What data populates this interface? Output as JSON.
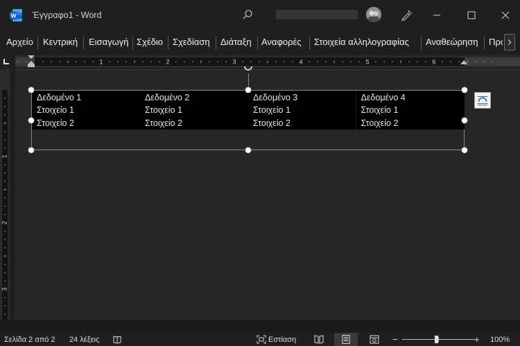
{
  "titlebar": {
    "document_title": "Έγγραφο1 - Word",
    "icons": [
      "word-logo-icon",
      "search-icon",
      "avatar",
      "pen-icon",
      "minimize-icon",
      "maximize-icon",
      "close-icon"
    ]
  },
  "ribbon": {
    "tabs": [
      "Αρχείο",
      "Κεντρική",
      "Εισαγωγή",
      "Σχέδιο",
      "Σχεδίαση",
      "Διάταξη",
      "Αναφορές",
      "Στοιχεία αλληλογραφίας",
      "Αναθεώρηση",
      "Προ"
    ]
  },
  "ruler": {
    "horizontal_numbers": [
      "1",
      "2",
      "3",
      "4",
      "5",
      "6"
    ],
    "vertical_numbers": [
      "1",
      "2",
      "3"
    ]
  },
  "document": {
    "table": {
      "rows": [
        [
          "Δεδομένο 1",
          "Δεδομένο 2",
          "Δεδομένο 3",
          "Δεδομένο 4"
        ],
        [
          "Στοιχείο 1",
          "Στοιχείο 1",
          "Στοιχείο 1",
          "Στοιχείο 1"
        ],
        [
          "Στοιχείο 2",
          "Στοιχείο 2",
          "Στοιχείο 2",
          "Στοιχείο 2"
        ]
      ]
    }
  },
  "statusbar": {
    "page_info": "Σελίδα 2 από 2",
    "word_count": "24 λέξεις",
    "focus_label": "Εστίαση",
    "zoom_minus": "−",
    "zoom_plus": "+",
    "zoom_level": "100%"
  },
  "colors": {
    "word_blue": "#185abd",
    "background": "#1f1f1f",
    "canvas": "#262626",
    "table_fill": "#000000"
  }
}
